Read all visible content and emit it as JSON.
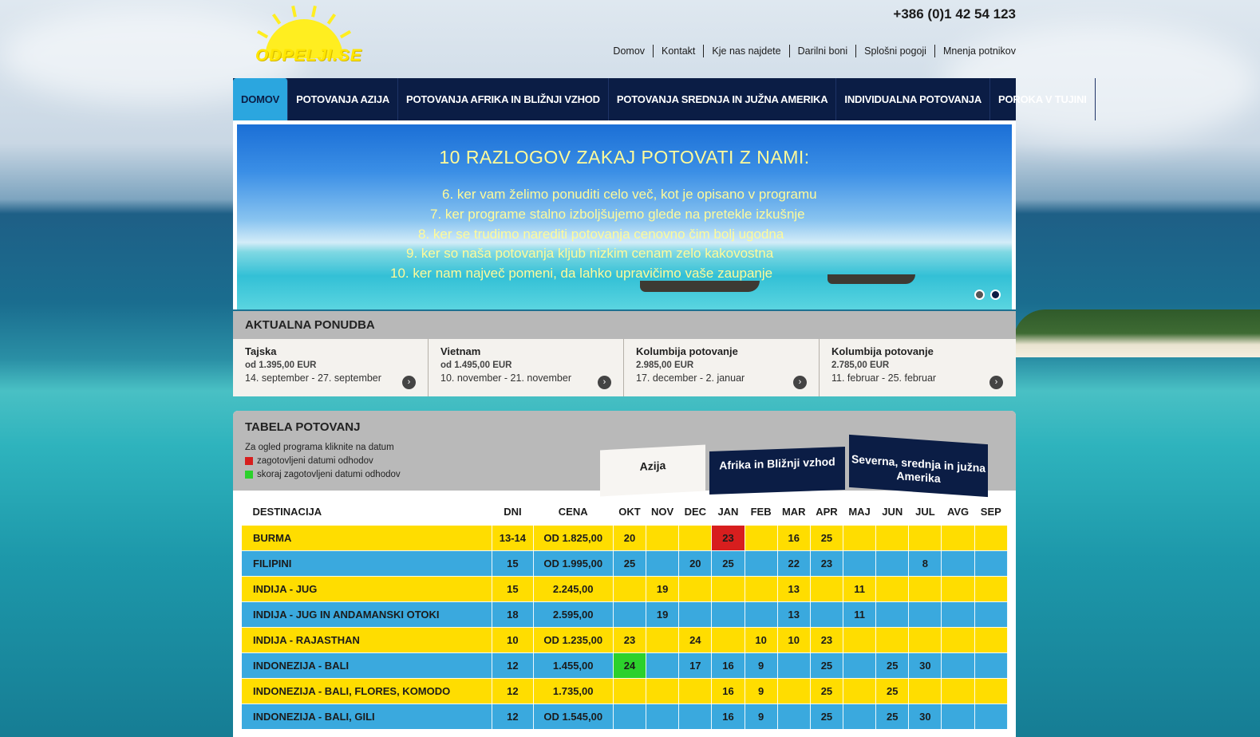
{
  "header": {
    "logo_text": "ODPELJI.SE",
    "phone": "+386 (0)1 42 54 123",
    "links": [
      "Domov",
      "Kontakt",
      "Kje nas najdete",
      "Darilni boni",
      "Splošni pogoji",
      "Mnenja potnikov"
    ]
  },
  "nav": {
    "items": [
      "DOMOV",
      "POTOVANJA AZIJA",
      "POTOVANJA AFRIKA IN BLIŽNJI VZHOD",
      "POTOVANJA SREDNJA IN JUŽNA AMERIKA",
      "INDIVIDUALNA POTOVANJA",
      "POROKA V TUJINI"
    ],
    "active_index": 0
  },
  "banner": {
    "title": "10 RAZLOGOV ZAKAJ POTOVATI Z NAMI:",
    "lines": [
      "6. ker vam želimo ponuditi celo več, kot je opisano v programu",
      "7. ker programe stalno izboljšujemo glede na pretekle izkušnje",
      "8. ker se trudimo narediti potovanja cenovno čim bolj ugodna",
      "9. ker so naša potovanja kljub nizkim cenam zelo kakovostna",
      "10. ker nam največ pomeni, da lahko upravičimo vaše zaupanje"
    ],
    "slide_count": 2,
    "active_slide": 1
  },
  "offers": {
    "title": "AKTUALNA PONUDBA",
    "items": [
      {
        "name": "Tajska",
        "price": "od 1.395,00 EUR",
        "dates": "14. september - 27. september"
      },
      {
        "name": "Vietnam",
        "price": "od 1.495,00 EUR",
        "dates": "10. november - 21. november"
      },
      {
        "name": "Kolumbija potovanje",
        "price": "2.985,00 EUR",
        "dates": "17. december - 2. januar"
      },
      {
        "name": "Kolumbija potovanje",
        "price": "2.785,00 EUR",
        "dates": "11. februar - 25. februar"
      }
    ]
  },
  "tabela": {
    "title": "TABELA POTOVANJ",
    "hint": "Za ogled programa kliknite na datum",
    "legend": [
      {
        "label": "zagotovljeni datumi odhodov",
        "color": "#d71e1e"
      },
      {
        "label": "skoraj zagotovljeni datumi odhodov",
        "color": "#2cd12c"
      }
    ],
    "tabs": [
      "Azija",
      "Afrika in Bližnji vzhod",
      "Severna, srednja in južna Amerika"
    ],
    "active_tab": 0,
    "columns": [
      "DESTINACIJA",
      "DNI",
      "CENA",
      "OKT",
      "NOV",
      "DEC",
      "JAN",
      "FEB",
      "MAR",
      "APR",
      "MAJ",
      "JUN",
      "JUL",
      "AVG",
      "SEP"
    ],
    "rows": [
      {
        "dest": "BURMA",
        "dni": "13-14",
        "cena": "OD 1.825,00",
        "months": [
          "20",
          "",
          "",
          "23",
          "",
          "16",
          "25",
          "",
          "",
          "",
          "",
          ""
        ],
        "red": [
          3
        ],
        "green": []
      },
      {
        "dest": "FILIPINI",
        "dni": "15",
        "cena": "OD 1.995,00",
        "months": [
          "25",
          "",
          "20",
          "25",
          "",
          "22",
          "23",
          "",
          "",
          "8",
          "",
          ""
        ],
        "red": [],
        "green": []
      },
      {
        "dest": "INDIJA - JUG",
        "dni": "15",
        "cena": "2.245,00",
        "months": [
          "",
          "19",
          "",
          "",
          "",
          "13",
          "",
          "11",
          "",
          "",
          "",
          ""
        ],
        "red": [],
        "green": []
      },
      {
        "dest": "INDIJA - JUG IN ANDAMANSKI OTOKI",
        "dni": "18",
        "cena": "2.595,00",
        "months": [
          "",
          "19",
          "",
          "",
          "",
          "13",
          "",
          "11",
          "",
          "",
          "",
          ""
        ],
        "red": [],
        "green": []
      },
      {
        "dest": "INDIJA - RAJASTHAN",
        "dni": "10",
        "cena": "OD 1.235,00",
        "months": [
          "23",
          "",
          "24",
          "",
          "10",
          "10",
          "23",
          "",
          "",
          "",
          "",
          ""
        ],
        "red": [],
        "green": []
      },
      {
        "dest": "INDONEZIJA - BALI",
        "dni": "12",
        "cena": "1.455,00",
        "months": [
          "24",
          "",
          "17",
          "16",
          "9",
          "",
          "25",
          "",
          "25",
          "30",
          "",
          ""
        ],
        "red": [],
        "green": [
          0
        ]
      },
      {
        "dest": "INDONEZIJA - BALI, FLORES, KOMODO",
        "dni": "12",
        "cena": "1.735,00",
        "months": [
          "",
          "",
          "",
          "16",
          "9",
          "",
          "25",
          "",
          "25",
          "",
          "",
          ""
        ],
        "red": [],
        "green": []
      },
      {
        "dest": "INDONEZIJA - BALI, GILI",
        "dni": "12",
        "cena": "OD 1.545,00",
        "months": [
          "",
          "",
          "",
          "16",
          "9",
          "",
          "25",
          "",
          "25",
          "30",
          "",
          ""
        ],
        "red": [],
        "green": []
      }
    ]
  }
}
